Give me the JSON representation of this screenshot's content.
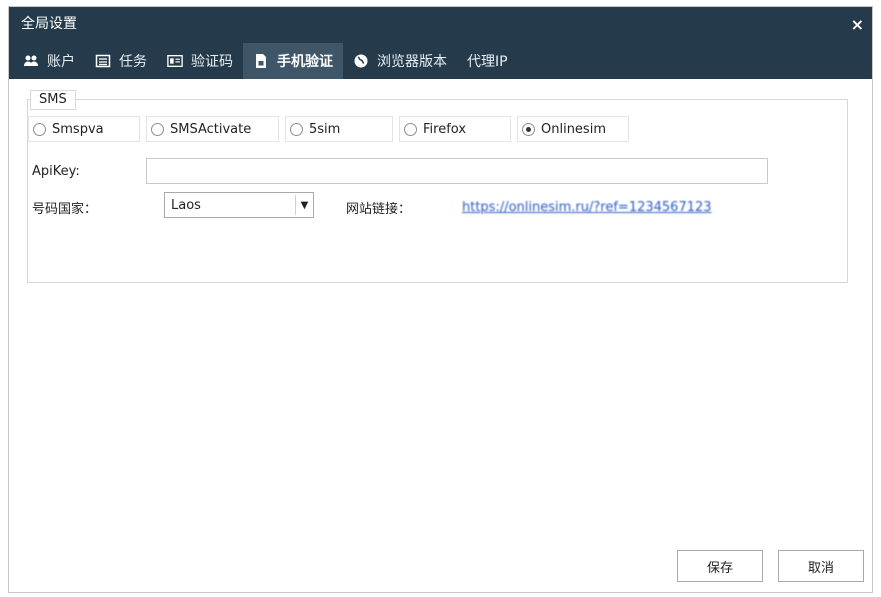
{
  "window": {
    "title": "全局设置",
    "close_icon": "×"
  },
  "tabs": [
    {
      "label": "账户",
      "icon": "users-icon"
    },
    {
      "label": "任务",
      "icon": "list-icon"
    },
    {
      "label": "验证码",
      "icon": "captcha-icon"
    },
    {
      "label": "手机验证",
      "icon": "phone-verify-icon",
      "active": true
    },
    {
      "label": "浏览器版本",
      "icon": "globe-icon"
    },
    {
      "label": "代理IP",
      "icon": ""
    }
  ],
  "sms": {
    "group_label": "SMS",
    "providers": [
      {
        "label": "Smspva",
        "checked": false
      },
      {
        "label": "SMSActivate",
        "checked": false
      },
      {
        "label": "5sim",
        "checked": false
      },
      {
        "label": "Firefox",
        "checked": false
      },
      {
        "label": "Onlinesim",
        "checked": true
      }
    ],
    "apikey_label": "ApiKey:",
    "apikey_value": "",
    "country_label": "号码国家：",
    "country_value": "Laos",
    "site_label": "网站链接：",
    "site_link": "https://onlinesim.ru/?ref=1234567123"
  },
  "buttons": {
    "save": "保存",
    "cancel": "取消"
  },
  "colors": {
    "titlebar": "#253b4c",
    "active_tab": "#3e5668",
    "link": "#2b59c3"
  }
}
